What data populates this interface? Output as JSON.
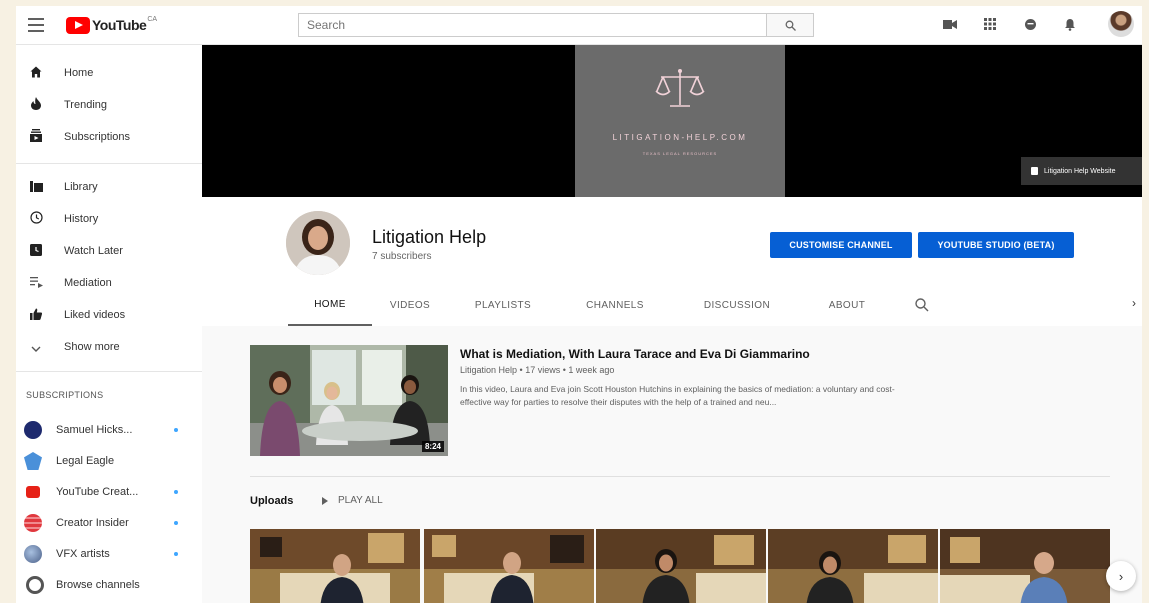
{
  "topbar": {
    "logo_text": "YouTube",
    "logo_sup": "CA",
    "search_placeholder": "Search"
  },
  "sidebar": {
    "primary": [
      {
        "label": "Home",
        "icon": "home-icon"
      },
      {
        "label": "Trending",
        "icon": "flame-icon"
      },
      {
        "label": "Subscriptions",
        "icon": "subscriptions-icon"
      }
    ],
    "library": [
      {
        "label": "Library",
        "icon": "library-icon"
      },
      {
        "label": "History",
        "icon": "history-icon"
      },
      {
        "label": "Watch Later",
        "icon": "clock-icon"
      },
      {
        "label": "Mediation",
        "icon": "playlist-icon"
      },
      {
        "label": "Liked videos",
        "icon": "thumbs-up-icon"
      },
      {
        "label": "Show more",
        "icon": "chevron-down-icon"
      }
    ],
    "subscriptions_heading": "SUBSCRIPTIONS",
    "subscriptions": [
      {
        "label": "Samuel Hicks...",
        "color": "#1e2a6e",
        "new": true
      },
      {
        "label": "Legal Eagle",
        "color": "#4a90d9",
        "new": false
      },
      {
        "label": "YouTube Creat...",
        "color": "#e62117",
        "new": true
      },
      {
        "label": "Creator Insider",
        "color": "#e0383e",
        "new": true
      },
      {
        "label": "VFX artists",
        "color": "#6a7fa8",
        "new": true
      },
      {
        "label": "Browse channels",
        "color": "#555555",
        "new": false
      }
    ]
  },
  "banner": {
    "title": "LITIGATION-HELP.COM",
    "subtitle": "TEXAS LEGAL RESOURCES",
    "link_label": "Litigation Help Website"
  },
  "channel": {
    "name": "Litigation Help",
    "subscribers": "7 subscribers",
    "customise_label": "CUSTOMISE CHANNEL",
    "studio_label": "YOUTUBE STUDIO (BETA)"
  },
  "tabs": [
    "HOME",
    "VIDEOS",
    "PLAYLISTS",
    "CHANNELS",
    "DISCUSSION",
    "ABOUT"
  ],
  "featured": {
    "title": "What is Mediation, With Laura Tarace and Eva Di Giammarino",
    "meta": "Litigation Help • 17 views • 1 week ago",
    "description": "In this video, Laura and Eva join Scott Houston Hutchins in explaining the basics of mediation: a voluntary and cost-effective way for parties to resolve their disputes with the help of a trained and neu...",
    "duration": "8:24"
  },
  "shelf": {
    "title": "Uploads",
    "play_all": "PLAY ALL"
  },
  "colors": {
    "accent": "#065fd4",
    "youtube_red": "#ff0000",
    "banner_center": "#6b6b6b",
    "banner_text": "#f1d2d8"
  }
}
